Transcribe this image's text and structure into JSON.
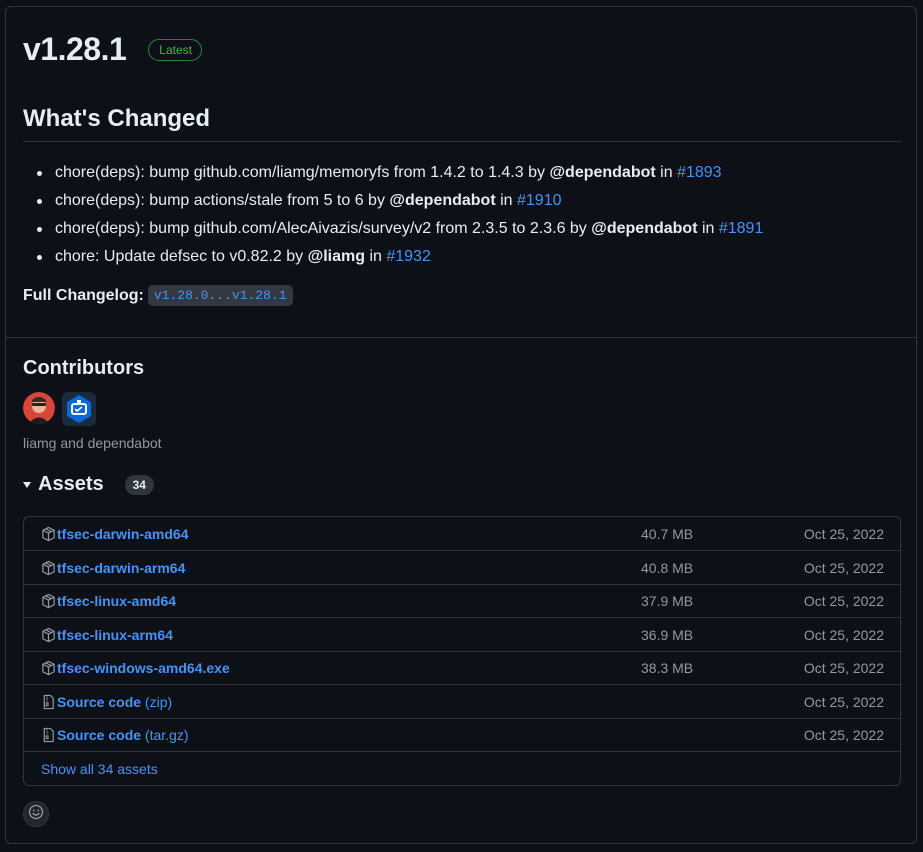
{
  "release": {
    "title": "v1.28.1",
    "badge": "Latest"
  },
  "changes": {
    "heading": "What's Changed",
    "items": [
      {
        "text": "chore(deps): bump github.com/liamg/memoryfs from 1.4.2 to 1.4.3 by ",
        "author": "@dependabot",
        "in": " in ",
        "pr": "#1893"
      },
      {
        "text": "chore(deps): bump actions/stale from 5 to 6 by ",
        "author": "@dependabot",
        "in": " in ",
        "pr": "#1910"
      },
      {
        "text": "chore(deps): bump github.com/AlecAivazis/survey/v2 from 2.3.5 to 2.3.6 by ",
        "author": "@dependabot",
        "in": " in ",
        "pr": "#1891"
      },
      {
        "text": "chore: Update defsec to v0.82.2 by ",
        "author": "@liamg",
        "in": " in ",
        "pr": "#1932"
      }
    ]
  },
  "changelog": {
    "label": "Full Changelog:",
    "range": "v1.28.0...v1.28.1"
  },
  "contributors": {
    "title": "Contributors",
    "names": "liamg and dependabot"
  },
  "assets": {
    "title": "Assets",
    "count": "34",
    "items": [
      {
        "name": "tfsec-darwin-amd64",
        "suffix": "",
        "size": "40.7 MB",
        "date": "Oct 25, 2022",
        "icon": "package-icon"
      },
      {
        "name": "tfsec-darwin-arm64",
        "suffix": "",
        "size": "40.8 MB",
        "date": "Oct 25, 2022",
        "icon": "package-icon"
      },
      {
        "name": "tfsec-linux-amd64",
        "suffix": "",
        "size": "37.9 MB",
        "date": "Oct 25, 2022",
        "icon": "package-icon"
      },
      {
        "name": "tfsec-linux-arm64",
        "suffix": "",
        "size": "36.9 MB",
        "date": "Oct 25, 2022",
        "icon": "package-icon"
      },
      {
        "name": "tfsec-windows-amd64.exe",
        "suffix": "",
        "size": "38.3 MB",
        "date": "Oct 25, 2022",
        "icon": "package-icon"
      },
      {
        "name": "Source code",
        "suffix": " (zip)",
        "size": "",
        "date": "Oct 25, 2022",
        "icon": "file-zip-icon"
      },
      {
        "name": "Source code",
        "suffix": " (tar.gz)",
        "size": "",
        "date": "Oct 25, 2022",
        "icon": "file-zip-icon"
      }
    ],
    "show_all": "Show all 34 assets"
  },
  "colors": {
    "background": "#0d1117",
    "border": "#30363d",
    "link": "#4493f8",
    "latest_green": "#3fb950",
    "muted_text": "#9198a1"
  }
}
